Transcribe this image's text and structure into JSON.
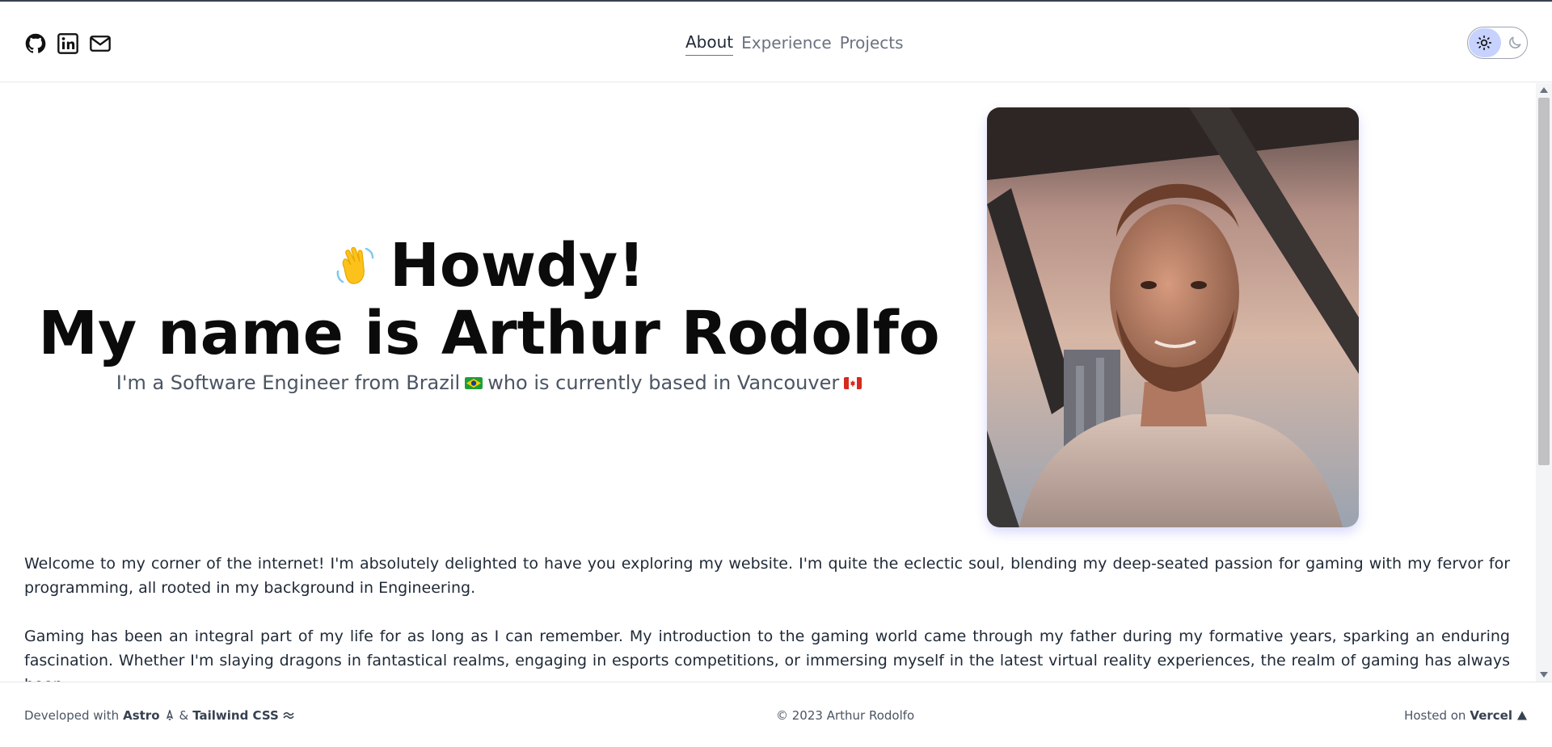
{
  "nav": {
    "items": [
      {
        "label": "About",
        "active": true
      },
      {
        "label": "Experience",
        "active": false
      },
      {
        "label": "Projects",
        "active": false
      }
    ]
  },
  "socials": {
    "icons": [
      "github-icon",
      "linkedin-icon",
      "mail-icon"
    ]
  },
  "theme_toggle": {
    "icons": [
      "sun-icon",
      "moon-icon"
    ],
    "active": "light"
  },
  "hero": {
    "greeting": "Howdy!",
    "name_line": "My name is Arthur Rodolfo",
    "sub_part1": "I'm a Software Engineer from Brazil",
    "sub_part2": "who is currently based in Vancouver"
  },
  "about": {
    "p1": "Welcome to my corner of the internet! I'm absolutely delighted to have you exploring my website. I'm quite the eclectic soul, blending my deep-seated passion for gaming with my fervor for programming, all rooted in my background in Engineering.",
    "p2": "Gaming has been an integral part of my life for as long as I can remember. My introduction to the gaming world came through my father during my formative years, sparking an enduring fascination. Whether I'm slaying dragons in fantastical realms, engaging in esports competitions, or immersing myself in the latest virtual reality experiences, the realm of gaming has always been"
  },
  "footer": {
    "developed_with": "Developed with",
    "astro": "Astro",
    "amp": "&",
    "tailwind": "Tailwind CSS",
    "copyright": "© 2023 Arthur Rodolfo",
    "hosted_on": "Hosted on",
    "vercel": "Vercel"
  },
  "colors": {
    "accent": "#c7d2fe",
    "text": "#111827",
    "muted": "#6b7280"
  }
}
